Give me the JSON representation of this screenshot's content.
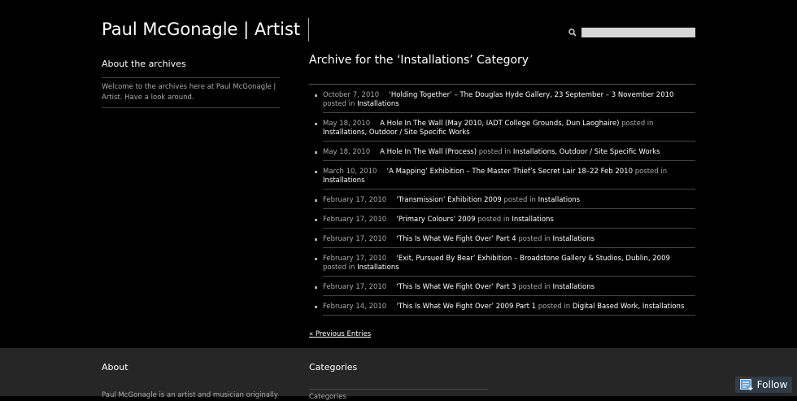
{
  "header": {
    "site_title": "Paul McGonagle | Artist",
    "search_placeholder": ""
  },
  "sidebar": {
    "heading": "About the archives",
    "text": "Welcome to the archives here at Paul McGonagle | Artist. Have a look around."
  },
  "main": {
    "title": "Archive for the ‘Installations’ Category",
    "posted_in": "posted in",
    "entries": [
      {
        "date": "October 7, 2010",
        "title": "‘Holding Together’ – The Douglas Hyde Gallery, 23 September – 3 November 2010",
        "categories": "Installations"
      },
      {
        "date": "May 18, 2010",
        "title": "A Hole In The Wall (May 2010, IADT College Grounds, Dun Laoghaire)",
        "categories": "Installations, Outdoor / Site Specific Works"
      },
      {
        "date": "May 18, 2010",
        "title": "A Hole In The Wall (Process)",
        "categories": "Installations, Outdoor / Site Specific Works"
      },
      {
        "date": "March 10, 2010",
        "title": "‘A Mapping’ Exhibition – The Master Thief’s Secret Lair 18–22 Feb 2010",
        "categories": "Installations"
      },
      {
        "date": "February 17, 2010",
        "title": "‘Transmission’ Exhibition 2009",
        "categories": "Installations"
      },
      {
        "date": "February 17, 2010",
        "title": "‘Primary Colours’ 2009",
        "categories": "Installations"
      },
      {
        "date": "February 17, 2010",
        "title": "‘This Is What We Fight Over’ Part 4",
        "categories": "Installations"
      },
      {
        "date": "February 17, 2010",
        "title": "‘Exit, Pursued By Bear’ Exhibition – Broadstone Gallery & Studios, Dublin, 2009",
        "categories": "Installations"
      },
      {
        "date": "February 17, 2010",
        "title": "‘This Is What We Fight Over’ Part 3",
        "categories": "Installations"
      },
      {
        "date": "February 14, 2010",
        "title": "‘This Is What We Fight Over’ 2009 Part 1",
        "categories": "Digital Based Work, Installations"
      }
    ],
    "prev_link": "« Previous Entries"
  },
  "footer": {
    "about_heading": "About",
    "about_text": "Paul McGonagle is an artist and musician originally",
    "categories_heading": "Categories",
    "categories_select": "Categories"
  },
  "follow": {
    "label": "Follow",
    "icon": "follow-icon"
  }
}
